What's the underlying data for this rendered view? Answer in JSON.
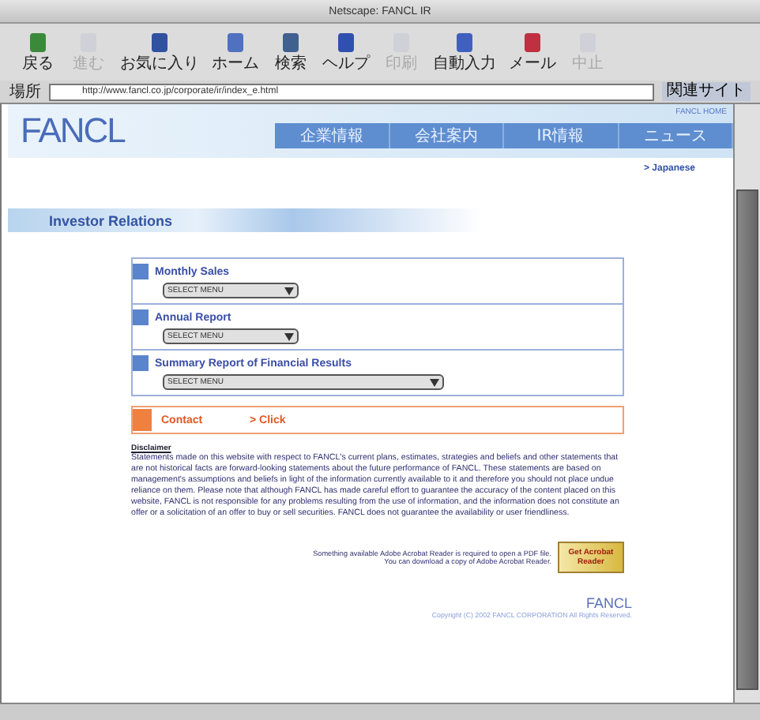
{
  "window": {
    "title": "Netscape: FANCL IR"
  },
  "toolbar": [
    {
      "label": "戻る",
      "disabled": false
    },
    {
      "label": "進む",
      "disabled": true
    },
    {
      "label": "お気に入り",
      "disabled": false
    },
    {
      "label": "ホーム",
      "disabled": false
    },
    {
      "label": "検索",
      "disabled": false
    },
    {
      "label": "ヘルプ",
      "disabled": false
    },
    {
      "label": "印刷",
      "disabled": true
    },
    {
      "label": "自動入力",
      "disabled": false
    },
    {
      "label": "メール",
      "disabled": false
    },
    {
      "label": "中止",
      "disabled": true
    }
  ],
  "address": {
    "label": "場所",
    "value": "http://www.fancl.co.jp/corporate/ir/index_e.html",
    "button": "関連サイト"
  },
  "site": {
    "logo": "FANCL",
    "top_link": "FANCL HOME",
    "nav": [
      {
        "label": "企業情報",
        "selected": false
      },
      {
        "label": "会社案内",
        "selected": false
      },
      {
        "label": "IR情報",
        "selected": false
      },
      {
        "label": "ニュース",
        "selected": false
      }
    ],
    "language_link": "> Japanese",
    "section_title": "Investor Relations",
    "menus": [
      {
        "title": "Monthly Sales",
        "select": "SELECT MENU",
        "wide": false
      },
      {
        "title": "Annual Report",
        "select": "SELECT MENU",
        "wide": false
      },
      {
        "title": "Summary Report of Financial Results",
        "select": "SELECT MENU",
        "wide": true
      }
    ],
    "contact": {
      "label": "Contact",
      "link": "> Click"
    },
    "disclaimer": {
      "title": "Disclaimer",
      "text": "Statements made on this website with respect to FANCL's current plans, estimates, strategies and beliefs and other statements that are not historical facts are forward-looking statements about the future performance of FANCL. These statements are based on management's assumptions and beliefs in light of the information currently available to it and therefore you should not place undue reliance on them. Please note that although FANCL has made careful effort to guarantee the accuracy of the content placed on this website, FANCL is not responsible for any problems resulting from the use of information, and the information does not constitute an offer or a solicitation of an offer to buy or sell securities. FANCL does not guarantee the availability or user friendliness."
    },
    "acrobat": {
      "line_1": "Something available Adobe Acrobat Reader is required to open a PDF file.",
      "line_2": "You can download a copy of Adobe Acrobat Reader.",
      "badge": "Get Acrobat Reader"
    },
    "footer": {
      "logo": "FANCL",
      "copyright": "Copyright (C) 2002 FANCL CORPORATION All Rights Reserved."
    }
  }
}
